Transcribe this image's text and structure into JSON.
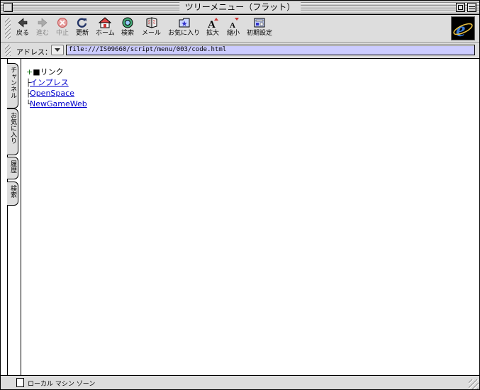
{
  "window": {
    "title": "ツリーメニュー（フラット）"
  },
  "toolbar": {
    "buttons": [
      {
        "label": "戻る",
        "icon": "back-arrow-icon",
        "enabled": true
      },
      {
        "label": "進む",
        "icon": "forward-arrow-icon",
        "enabled": false
      },
      {
        "label": "中止",
        "icon": "stop-icon",
        "enabled": false
      },
      {
        "label": "更新",
        "icon": "refresh-icon",
        "enabled": true
      },
      {
        "label": "ホーム",
        "icon": "home-icon",
        "enabled": true
      },
      {
        "label": "検索",
        "icon": "search-icon",
        "enabled": true
      },
      {
        "label": "メール",
        "icon": "mail-icon",
        "enabled": true
      },
      {
        "label": "お気に入り",
        "icon": "favorites-icon",
        "enabled": true
      },
      {
        "label": "拡大",
        "icon": "text-larger-icon",
        "enabled": true
      },
      {
        "label": "縮小",
        "icon": "text-smaller-icon",
        "enabled": true
      },
      {
        "label": "初期設定",
        "icon": "preferences-icon",
        "enabled": true
      }
    ],
    "brand_logo": "ie-logo-icon"
  },
  "address": {
    "label": "アドレス：",
    "value": "file:///IS09660/script/menu/003/code.html"
  },
  "side_tabs": [
    "チャンネル",
    "お気に入り",
    "履歴",
    "検索"
  ],
  "tree": {
    "root": {
      "toggle": "+",
      "marker": "■",
      "label": "リンク"
    },
    "items": [
      {
        "connector": "├",
        "label": "インプレス"
      },
      {
        "connector": "├",
        "label": "OpenSpace"
      },
      {
        "connector": "└",
        "label": "NewGameWeb"
      }
    ]
  },
  "status": {
    "text": "ローカル マシン ゾーン",
    "icon": "zone-icon"
  },
  "colors": {
    "address_bg": "#ccccff",
    "link": "#0000cc",
    "toggle": "#006600",
    "chrome": "#dddddd"
  }
}
